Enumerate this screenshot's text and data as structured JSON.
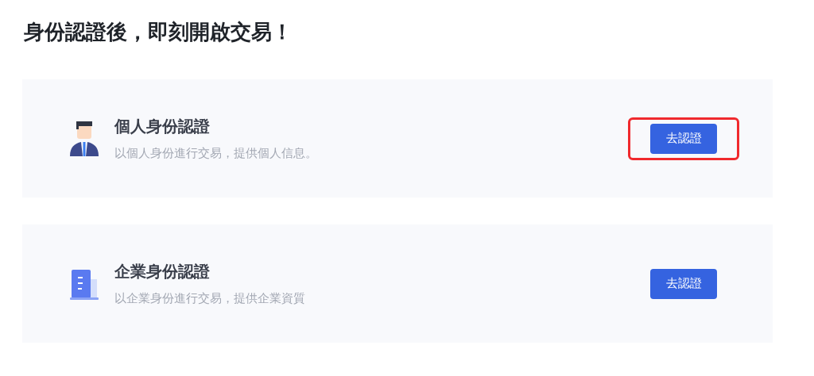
{
  "heading": "身份認證後，即刻開啟交易！",
  "cards": [
    {
      "kind": "person",
      "title": "個人身份認證",
      "description": "以個人身份進行交易，提供個人信息。",
      "button": "去認證",
      "highlighted": true
    },
    {
      "kind": "company",
      "title": "企業身份認證",
      "description": "以企業身份進行交易，提供企業資質",
      "button": "去認證",
      "highlighted": false
    }
  ]
}
